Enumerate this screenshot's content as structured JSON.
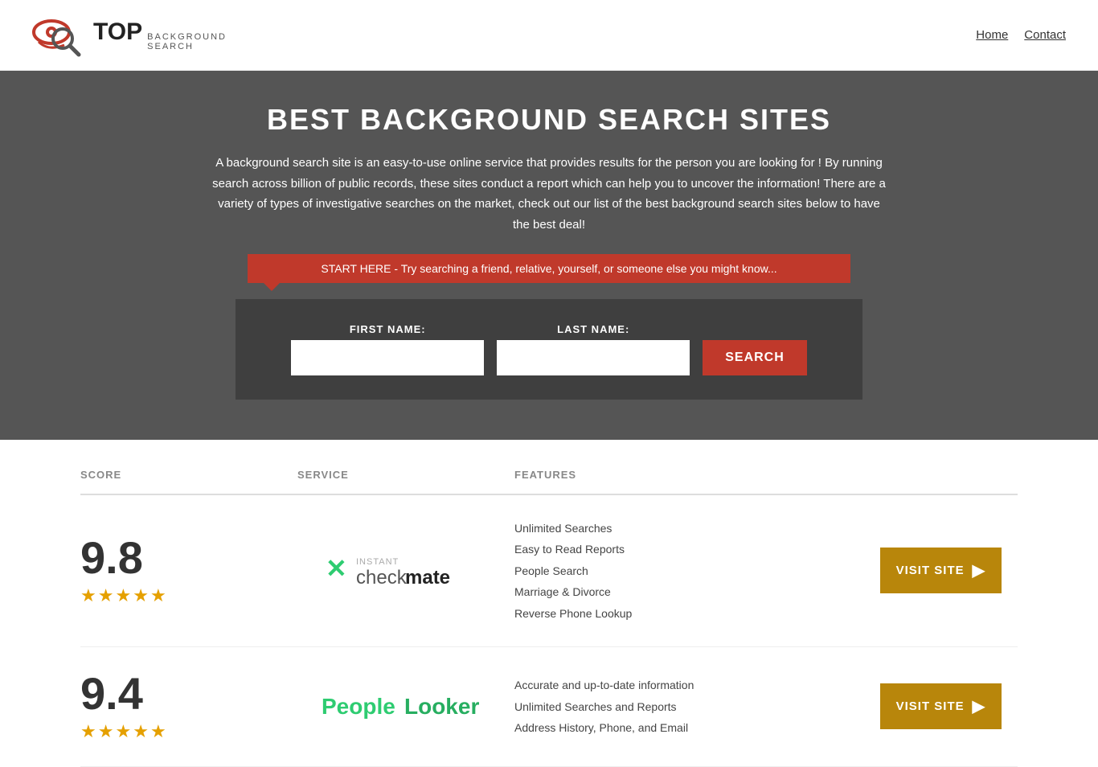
{
  "header": {
    "logo_top": "TOP",
    "logo_sub_line1": "BACKGROUND",
    "logo_sub_line2": "SEARCH",
    "nav": {
      "home": "Home",
      "contact": "Contact"
    }
  },
  "hero": {
    "title": "BEST BACKGROUND SEARCH SITES",
    "description": "A background search site is an easy-to-use online service that provides results  for the person you are looking for ! By  running  search across billion of public records, these sites conduct  a report which can help you to uncover the information! There are a variety of types of investigative searches on the market, check out our  list of the best background search sites below to have the best deal!",
    "callout": "START HERE - Try searching a friend, relative, yourself, or someone else you might know...",
    "form": {
      "first_name_label": "FIRST NAME:",
      "last_name_label": "LAST NAME:",
      "search_button": "SEARCH"
    }
  },
  "table": {
    "headers": {
      "score": "SCORE",
      "service": "SERVICE",
      "features": "FEATURES"
    },
    "rows": [
      {
        "score": "9.8",
        "stars": 4.5,
        "service_name": "Instant Checkmate",
        "features": [
          "Unlimited Searches",
          "Easy to Read Reports",
          "People Search",
          "Marriage & Divorce",
          "Reverse Phone Lookup"
        ],
        "visit_button": "VISIT SITE"
      },
      {
        "score": "9.4",
        "stars": 4.5,
        "service_name": "PeopleLooker",
        "features": [
          "Accurate and up-to-date information",
          "Unlimited Searches and Reports",
          "Address History, Phone, and Email"
        ],
        "visit_button": "VISIT SITE"
      }
    ]
  }
}
